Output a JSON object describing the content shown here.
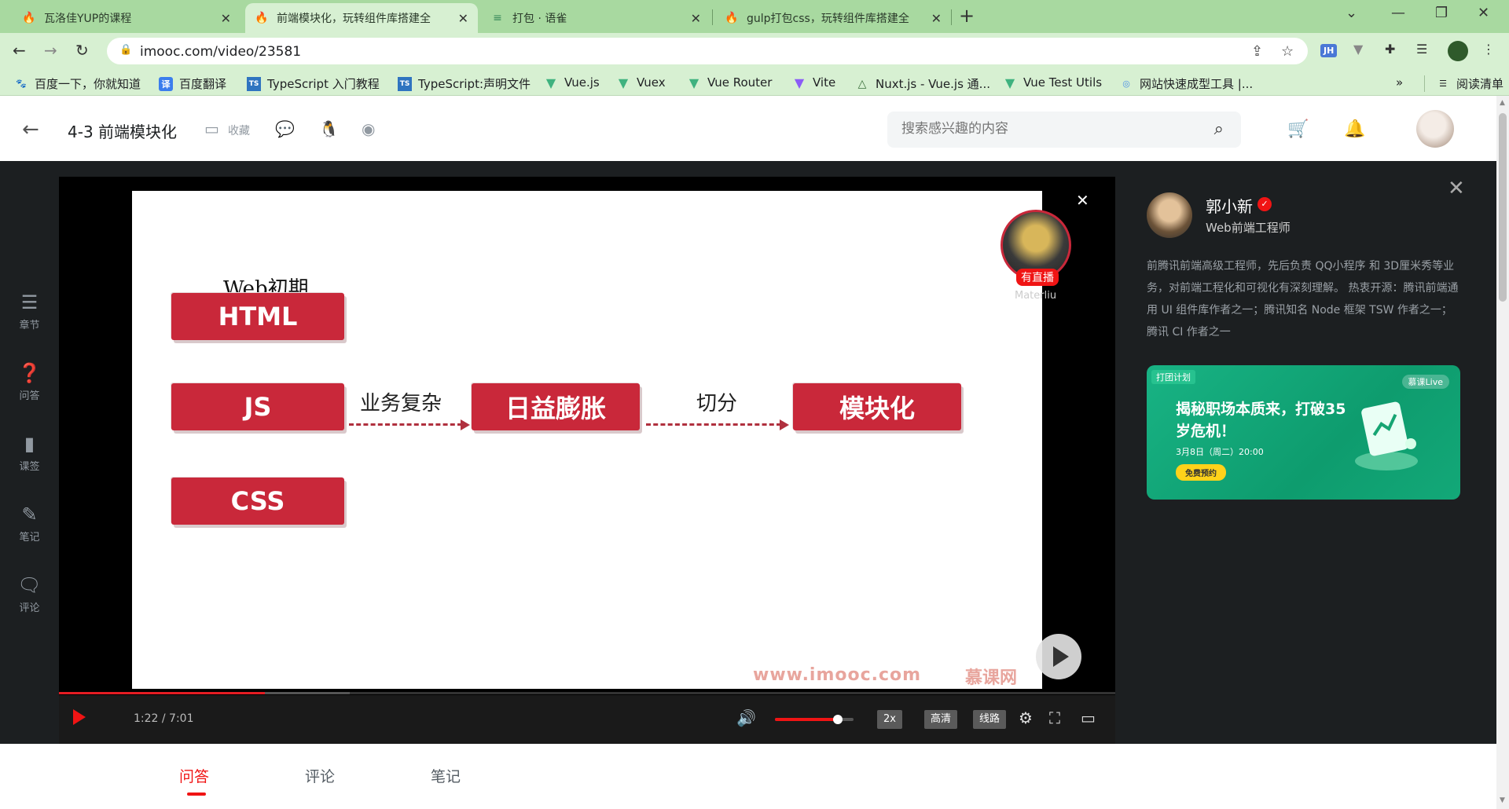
{
  "browser": {
    "tabs": [
      {
        "label": "瓦洛佳YUP的课程",
        "icon": "imooc-flame-icon"
      },
      {
        "label": "前端模块化，玩转组件库搭建全",
        "icon": "imooc-flame-icon"
      },
      {
        "label": "打包 · 语雀",
        "icon": "yuque-icon"
      },
      {
        "label": "gulp打包css，玩转组件库搭建全",
        "icon": "imooc-flame-icon"
      }
    ],
    "active_tab_index": 1,
    "url": "imooc.com/video/23581",
    "bookmarks": [
      {
        "label": "百度一下，你就知道",
        "icon": "baidu-paw-icon"
      },
      {
        "label": "百度翻译",
        "icon": "fanyi-icon",
        "glyph": "译"
      },
      {
        "label": "TypeScript 入门教程",
        "icon": "typescript-icon",
        "glyph": "TS"
      },
      {
        "label": "TypeScript:声明文件",
        "icon": "typescript-icon",
        "glyph": "TS"
      },
      {
        "label": "Vue.js",
        "icon": "vue-icon"
      },
      {
        "label": "Vuex",
        "icon": "vue-icon"
      },
      {
        "label": "Vue Router",
        "icon": "vue-icon"
      },
      {
        "label": "Vite",
        "icon": "vite-icon"
      },
      {
        "label": "Nuxt.js - Vue.js 通...",
        "icon": "nuxt-icon"
      },
      {
        "label": "Vue Test Utils",
        "icon": "vue-icon"
      },
      {
        "label": "网站快速成型工具 |...",
        "icon": "site-icon"
      }
    ],
    "bookmarks_overflow": "»",
    "reading_list": "阅读清单",
    "extension_jh": "JH",
    "colors": {
      "chrome": "#a8d9a0",
      "toolbar": "#d7f0d2"
    }
  },
  "header": {
    "lesson_title": "4-3 前端模块化",
    "favorite_label": "收藏",
    "search_placeholder": "搜索感兴趣的内容"
  },
  "sidebar": {
    "items": [
      {
        "label": "章节",
        "icon": "chapter-list-icon"
      },
      {
        "label": "问答",
        "icon": "question-icon"
      },
      {
        "label": "课签",
        "icon": "bookmark-icon"
      },
      {
        "label": "笔记",
        "icon": "note-pen-icon"
      },
      {
        "label": "评论",
        "icon": "comment-icon"
      }
    ]
  },
  "slide": {
    "heading": "Web初期",
    "boxes": [
      "HTML",
      "JS",
      "CSS",
      "日益膨胀",
      "模块化"
    ],
    "arrow_labels": [
      "业务复杂",
      "切分"
    ],
    "watermark": "www.imooc.com",
    "watermark_brand": "慕课网",
    "colors": {
      "box": "#c9283a",
      "arrow": "#b0303e"
    }
  },
  "live": {
    "tag": "有直播",
    "name": "Materliu"
  },
  "player": {
    "time": "1:22 / 7:01",
    "progress_fraction": 0.195,
    "volume_fraction": 0.8,
    "speed": "2x",
    "quality": "高清",
    "route": "线路",
    "accent": "#f01414"
  },
  "teacher": {
    "name": "郭小新",
    "title": "Web前端工程师",
    "bio": "前腾讯前端高级工程师，先后负责 QQ小程序 和 3D厘米秀等业务，对前端工程化和可视化有深刻理解。 热衷开源：腾讯前端通用 UI 组件库作者之一；腾讯知名 Node 框架 TSW 作者之一；腾讯 CI 作者之一"
  },
  "promo": {
    "tag": "打团计划",
    "live_badge": "慕课Live",
    "headline": "揭秘职场本质来，打破35岁危机！",
    "date": "3月8日（周二）20:00",
    "button": "免费预约"
  },
  "content_tabs": {
    "items": [
      "问答",
      "评论",
      "笔记"
    ],
    "active_index": 0
  }
}
